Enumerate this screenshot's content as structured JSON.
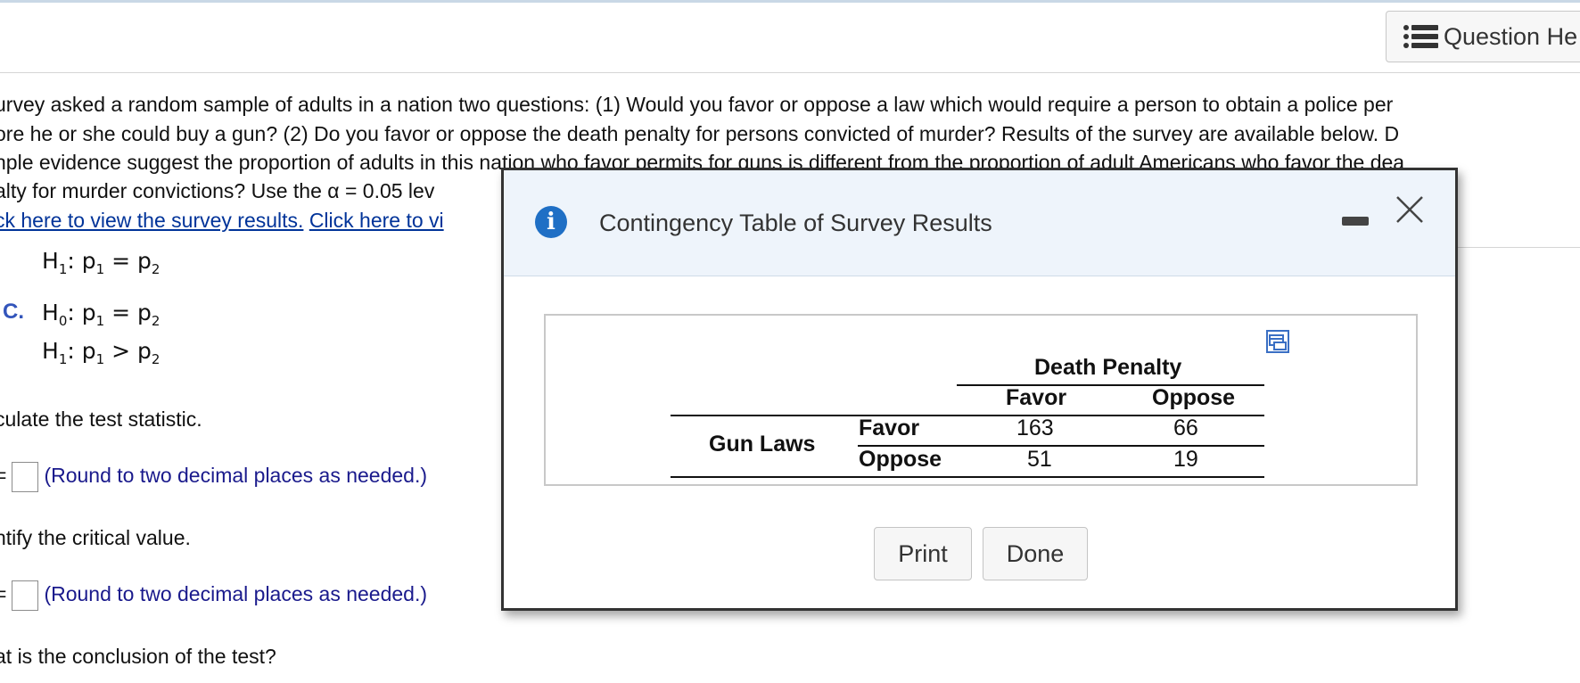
{
  "header": {
    "question_help_label": "Question He"
  },
  "problem": {
    "lines": [
      "urvey asked a random sample of adults in a nation two questions: (1) Would you favor or oppose a law which would require a person to obtain a police per",
      "ore he or she could buy a gun? (2) Do you favor or oppose the death penalty for persons convicted of murder? Results of the survey are available below. D",
      "nple evidence suggest the proportion of adults in this nation who favor permits for guns is different from the proportion of adult Americans who favor the dea",
      "alty for murder convictions? Use the α = 0.05 lev"
    ],
    "link_survey": "ck here to view the survey results.",
    "link_other": "Click here to vi"
  },
  "hypotheses": {
    "b_h1": ": p",
    "c_label": "C.",
    "c_h0": ": p",
    "c_h1": ": p"
  },
  "steps": {
    "test_stat_prompt": "culate the test statistic.",
    "round_hint_1": "(Round to two decimal places as needed.)",
    "critical_prompt": "ntify the critical value.",
    "round_hint_2": "(Round to two decimal places as needed.)",
    "conclusion_prompt": "at is the conclusion of the test?",
    "equals": "="
  },
  "modal": {
    "title": "Contingency Table of Survey Results",
    "table": {
      "column_group": "Death Penalty",
      "columns": [
        "Favor",
        "Oppose"
      ],
      "row_group": "Gun Laws",
      "rows": [
        {
          "label": "Favor",
          "values": [
            "163",
            "66"
          ]
        },
        {
          "label": "Oppose",
          "values": [
            "51",
            "19"
          ]
        }
      ]
    },
    "print_label": "Print",
    "done_label": "Done"
  },
  "colors": {
    "link": "#003399",
    "hint": "#1a1a8c",
    "info_icon": "#1f6fc5",
    "modal_header_bg": "#eef4fb"
  }
}
